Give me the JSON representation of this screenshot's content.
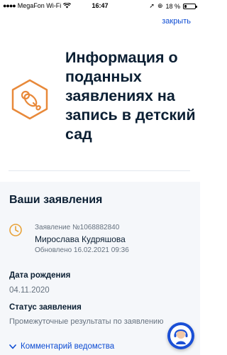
{
  "status_bar": {
    "carrier": "MegaFon Wi-Fi",
    "time": "16:47",
    "battery": "18 %",
    "battery_level": 0.18
  },
  "header": {
    "close_label": "закрыть"
  },
  "hero": {
    "title": "Информация о поданных заявлениях на запись в детский сад",
    "icon": "pacifier-icon"
  },
  "applications": {
    "section_title": "Ваши заявления",
    "item": {
      "number": "Заявление №1068882840",
      "child_name": "Мирослава Кудряшова",
      "updated": "Обновлено 16.02.2021 09:36"
    }
  },
  "details": {
    "dob_label": "Дата рождения",
    "dob_value": "04.11.2020",
    "status_label": "Статус заявления",
    "status_value": "Промежуточные результаты по заявлению",
    "comment_label": "Комментарий ведомства"
  },
  "colors": {
    "accent": "#0d4cd3",
    "icon_orange": "#e8893a",
    "text": "#0b1f33",
    "muted": "#66727f",
    "background_grey": "#f5f7fa"
  }
}
